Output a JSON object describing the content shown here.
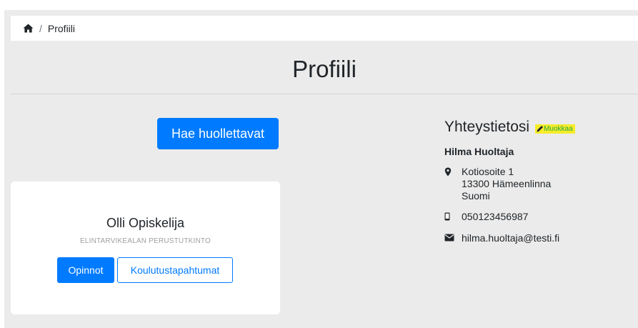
{
  "breadcrumb": {
    "home_icon": "home-icon",
    "separator": "/",
    "current": "Profiili"
  },
  "page": {
    "title": "Profiili"
  },
  "actions": {
    "fetch_dependents_label": "Hae huollettavat"
  },
  "student": {
    "name": "Olli Opiskelija",
    "degree": "ELINTARVIKEALAN PERUSTUTKINTO",
    "studies_label": "Opinnot",
    "events_label": "Koulutustapahtumat"
  },
  "contact": {
    "heading": "Yhteystietosi",
    "edit_label": "Muokkaa",
    "name": "Hilma Huoltaja",
    "address_line1": "Kotiosoite 1",
    "address_line2": "13300 Hämeenlinna",
    "address_line3": "Suomi",
    "phone": "050123456987",
    "email": "hilma.huoltaja@testi.fi"
  },
  "colors": {
    "primary": "#007bff",
    "highlight": "#f5ec2a",
    "edit_text": "#28a745",
    "background": "#ebebeb"
  }
}
